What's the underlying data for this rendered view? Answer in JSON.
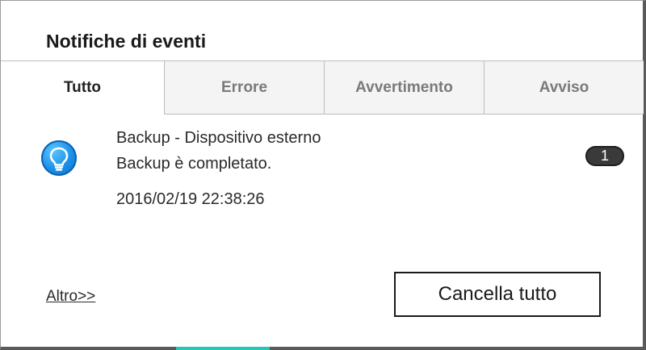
{
  "dialog": {
    "title": "Notifiche di eventi"
  },
  "tabs": [
    {
      "label": "Tutto",
      "active": true
    },
    {
      "label": "Errore",
      "active": false
    },
    {
      "label": "Avvertimento",
      "active": false
    },
    {
      "label": "Avviso",
      "active": false
    }
  ],
  "event": {
    "icon": "lightbulb-icon",
    "icon_color": "#1a8fe6",
    "source": "Backup - Dispositivo esterno",
    "message": "Backup è completato.",
    "timestamp": "2016/02/19 22:38:26",
    "count": "1"
  },
  "footer": {
    "more_link": "Altro>>",
    "clear_all_button": "Cancella tutto"
  },
  "colors": {
    "accent": "#24c6b4",
    "badge_bg": "#3a3a3a"
  }
}
